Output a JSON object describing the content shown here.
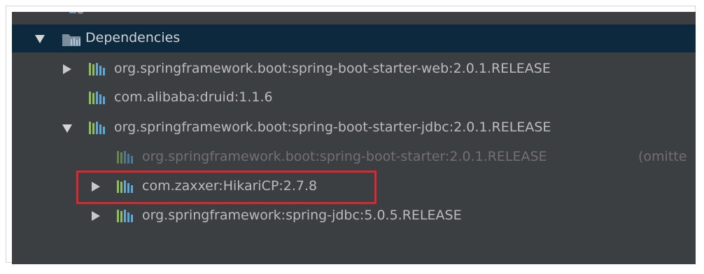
{
  "tree": {
    "dependencies_label": "Dependencies",
    "items": [
      {
        "label": "org.springframework.boot:spring-boot-starter-web:2.0.1.RELEASE",
        "expander": "collapsed"
      },
      {
        "label": "com.alibaba:druid:1.1.6",
        "expander": "none"
      },
      {
        "label": "org.springframework.boot:spring-boot-starter-jdbc:2.0.1.RELEASE",
        "expander": "expanded"
      },
      {
        "label": "org.springframework.boot:spring-boot-starter:2.0.1.RELEASE",
        "suffix": "(omitte",
        "expander": "none",
        "dimmed": true
      },
      {
        "label": "com.zaxxer:HikariCP:2.7.8",
        "expander": "collapsed",
        "highlighted": true
      },
      {
        "label": "org.springframework:spring-jdbc:5.0.5.RELEASE",
        "expander": "collapsed"
      }
    ]
  },
  "colors": {
    "panel_bg": "#3c3f41",
    "selected_bg": "#0d293e",
    "text": "#bbbbbb",
    "dim_text": "#6f7173",
    "highlight_border": "#e0262c",
    "lib_icon": "#8fbf5c"
  },
  "icons": {
    "folder": "maven-dependencies-folder-icon",
    "library": "library-bars-icon"
  }
}
